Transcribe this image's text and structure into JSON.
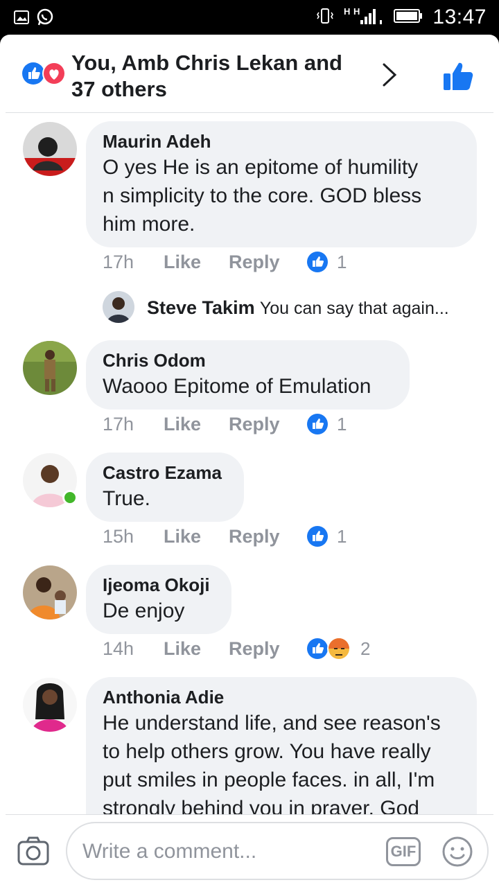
{
  "status_bar": {
    "time": "13:47",
    "network": "H H"
  },
  "header": {
    "title": "You, Amb Chris Lekan and 37 others"
  },
  "comments": [
    {
      "author": "Maurin Adeh",
      "text_lines": [
        "O yes He is an epitome  of humility",
        "n simplicity to the core. GOD bless",
        "him more."
      ],
      "time": "17h",
      "like_label": "Like",
      "reply_label": "Reply",
      "reaction_count": "1",
      "reply": {
        "author": "Steve Takim",
        "text": "You can say that again..."
      }
    },
    {
      "author": "Chris Odom",
      "text_lines": [
        "Waooo Epitome of Emulation"
      ],
      "time": "17h",
      "like_label": "Like",
      "reply_label": "Reply",
      "reaction_count": "1"
    },
    {
      "author": "Castro Ezama",
      "text_lines": [
        "True."
      ],
      "time": "15h",
      "like_label": "Like",
      "reply_label": "Reply",
      "reaction_count": "1"
    },
    {
      "author": "Ijeoma Okoji",
      "text_lines": [
        "De enjoy"
      ],
      "time": "14h",
      "like_label": "Like",
      "reply_label": "Reply",
      "reaction_count": "2"
    },
    {
      "author": "Anthonia Adie",
      "text_lines": [
        "He understand life, and see reason's",
        "to help others grow. You have really",
        "put smiles in people faces. in all, I'm",
        "strongly behind you in prayer. God"
      ]
    }
  ],
  "composer": {
    "placeholder": "Write a comment...",
    "gif_label": "GIF"
  },
  "colors": {
    "facebook_blue": "#1877f2",
    "love_red": "#f33e58",
    "online_green": "#42b72a",
    "meta_gray": "#90949c"
  },
  "icons": [
    "picture-icon",
    "whatsapp-icon",
    "vibrate-icon",
    "signal-icon",
    "battery-icon",
    "like-reaction-icon",
    "love-reaction-icon",
    "angry-reaction-icon",
    "chevron-right-icon",
    "thumbs-up-icon",
    "camera-icon",
    "gif-icon",
    "smiley-icon"
  ]
}
